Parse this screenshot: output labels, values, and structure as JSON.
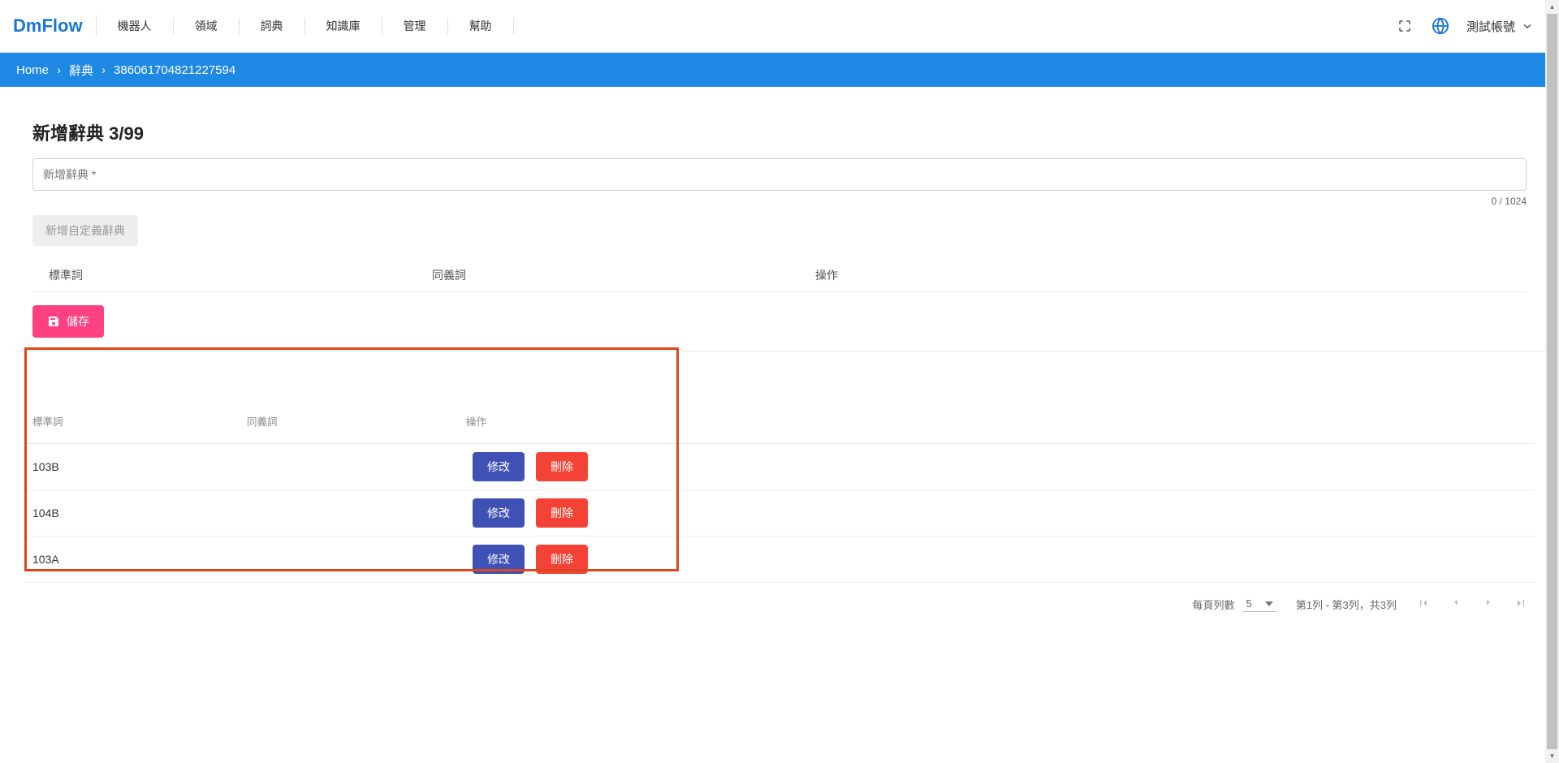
{
  "logo": "DmFlow",
  "nav": [
    "機器人",
    "領域",
    "詞典",
    "知識庫",
    "管理",
    "幫助"
  ],
  "account": "測試帳號",
  "breadcrumb": {
    "home": "Home",
    "mid": "辭典",
    "id": "386061704821227594"
  },
  "page": {
    "title": "新增辭典 3/99",
    "inputPlaceholder": "新增辭典 *",
    "counter": "0 / 1024",
    "addCustom": "新增自定義辭典",
    "saveLabel": "儲存"
  },
  "cols": {
    "std": "標準詞",
    "syn": "同義詞",
    "ops": "操作"
  },
  "rows": [
    {
      "std": "103B",
      "syn": ""
    },
    {
      "std": "104B",
      "syn": ""
    },
    {
      "std": "103A",
      "syn": ""
    }
  ],
  "rowActions": {
    "edit": "修改",
    "del": "刪除"
  },
  "paginator": {
    "perPageLabel": "每頁列數",
    "perPageValue": "5",
    "rangeText": "第1列 - 第3列，共3列"
  }
}
